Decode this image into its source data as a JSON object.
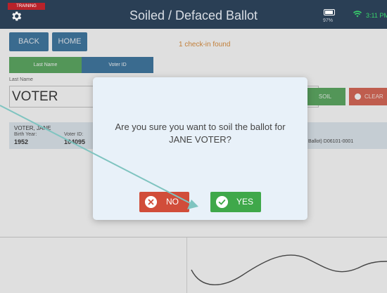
{
  "header": {
    "training_badge": "TRAINING",
    "title": "Soiled / Defaced Ballot",
    "battery_pct": "97%",
    "time": "3:11 PM"
  },
  "nav": {
    "back_label": "BACK",
    "home_label": "HOME"
  },
  "status": {
    "checkin_text": "1 check-in found"
  },
  "search_mode": {
    "tabs": [
      "Last Name",
      "Voter ID"
    ],
    "selected": "Last Name"
  },
  "search": {
    "field_label": "Last Name",
    "value": "VOTER"
  },
  "actions": {
    "soil_label": "SOIL",
    "clear_label": "CLEAR"
  },
  "result": {
    "name": "VOTER, JANE",
    "birth_year_label": "Birth Year:",
    "birth_year": "1952",
    "voter_id_label": "Voter ID:",
    "voter_id": "104095",
    "ballot_text": "Ballot) D06101-0001"
  },
  "dialog": {
    "message_line1": "Are you sure you want to soil the ballot for",
    "message_line2": "JANE VOTER?",
    "no_label": "NO",
    "yes_label": "YES"
  },
  "colors": {
    "header_bg": "#2a3f55",
    "nav_button": "#1b5f91",
    "segment_selected": "#3d9a45",
    "segment_unselected": "#1b5f91",
    "soil_button": "#3d9a45",
    "clear_button": "#d34b36",
    "no_button": "#d14d3a",
    "yes_button": "#3fa84a",
    "checkin_text": "#d67a1a",
    "time_text": "#39d36b"
  },
  "icons": {
    "settings": "gear-icon",
    "battery": "battery-icon",
    "wifi": "wifi-icon",
    "clear": "clear-icon",
    "no": "close-icon",
    "yes": "check-icon"
  }
}
